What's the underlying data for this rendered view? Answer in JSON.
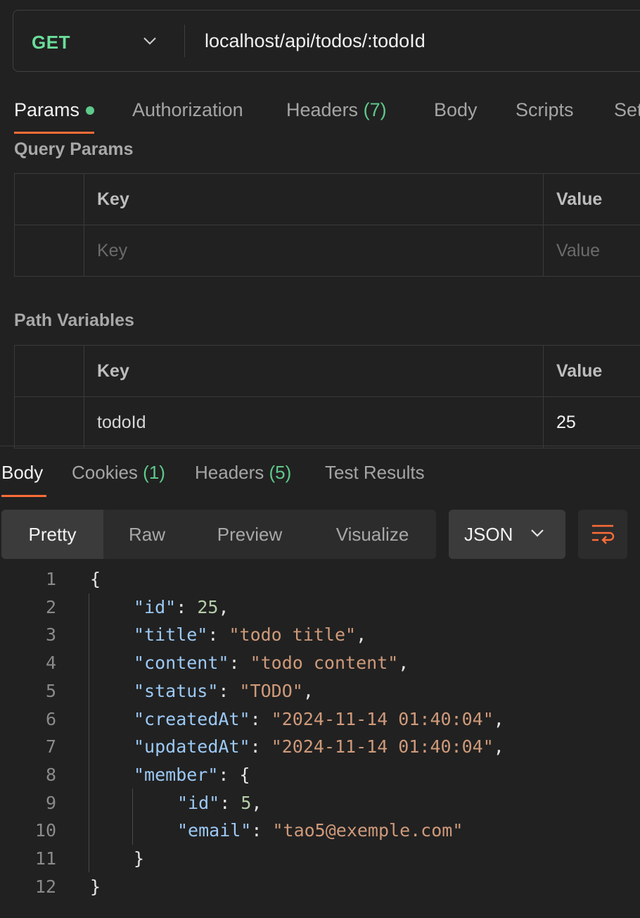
{
  "request": {
    "method": "GET",
    "url": "localhost/api/todos/:todoId"
  },
  "request_tabs": {
    "params": "Params",
    "authorization": "Authorization",
    "headers": "Headers",
    "headers_count": "(7)",
    "body": "Body",
    "scripts": "Scripts",
    "settings": "Set"
  },
  "query_params": {
    "title": "Query Params",
    "key_header": "Key",
    "value_header": "Value",
    "key_placeholder": "Key",
    "value_placeholder": "Value"
  },
  "path_variables": {
    "title": "Path Variables",
    "key_header": "Key",
    "value_header": "Value",
    "rows": [
      {
        "key": "todoId",
        "value": "25"
      }
    ]
  },
  "response_tabs": {
    "body": "Body",
    "cookies": "Cookies",
    "cookies_count": "(1)",
    "headers": "Headers",
    "headers_count": "(5)",
    "test_results": "Test Results"
  },
  "view_modes": {
    "pretty": "Pretty",
    "raw": "Raw",
    "preview": "Preview",
    "visualize": "Visualize",
    "selected": "Pretty"
  },
  "format": {
    "selected": "JSON"
  },
  "code_lines": [
    {
      "num": "1",
      "text": "{"
    },
    {
      "num": "2",
      "text": "\"id\": 25,"
    },
    {
      "num": "3",
      "text": "\"title\": \"todo title\","
    },
    {
      "num": "4",
      "text": "\"content\": \"todo content\","
    },
    {
      "num": "5",
      "text": "\"status\": \"TODO\","
    },
    {
      "num": "6",
      "text": "\"createdAt\": \"2024-11-14 01:40:04\","
    },
    {
      "num": "7",
      "text": "\"updatedAt\": \"2024-11-14 01:40:04\","
    },
    {
      "num": "8",
      "text": "\"member\": {"
    },
    {
      "num": "9",
      "text": "\"id\": 5,"
    },
    {
      "num": "10",
      "text": "\"email\": \"tao5@exemple.com\""
    },
    {
      "num": "11",
      "text": "}"
    },
    {
      "num": "12",
      "text": "}"
    }
  ],
  "colors": {
    "method_get": "#6bdd9a",
    "accent": "#ff6c37",
    "count_green": "#5fc98b",
    "json_key": "#9cc9f5",
    "json_string": "#cf9a7a",
    "json_number": "#b5cea8"
  },
  "icons": {
    "method_dropdown": "chevron-down-icon",
    "format_dropdown": "chevron-down-icon",
    "wrap": "text-wrap-icon"
  }
}
